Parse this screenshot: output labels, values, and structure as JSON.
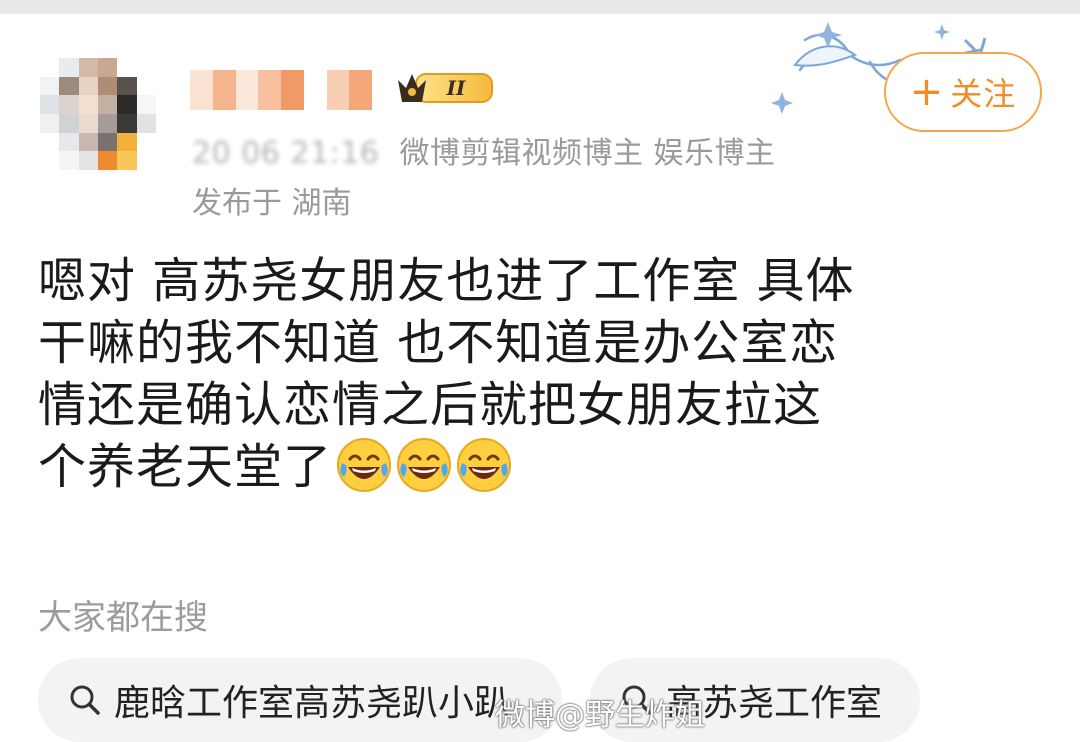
{
  "header": {
    "timestamp": "20  06 21:16",
    "tags": "微博剪辑视频博主 娱乐博主",
    "location": "发布于 湖南",
    "vip_level": "II",
    "follow_label": "关注"
  },
  "post": {
    "lines": [
      "嗯对 高苏尧女朋友也进了工作室 具体",
      "干嘛的我不知道  也不知道是办公室恋",
      "情还是确认恋情之后就把女朋友拉这",
      "个养老天堂了"
    ],
    "emoji_icon": "laughing-crying-emoji",
    "emoji_count": 3
  },
  "search": {
    "title": "大家都在搜",
    "chips": [
      "鹿晗工作室高苏尧趴小趴",
      "高苏尧工作室"
    ]
  },
  "watermark": "微博@野生炸姐",
  "colors": {
    "accent": "#f08d28",
    "meta_text": "#9a9a9a",
    "chip_bg": "#f3f3f3"
  }
}
